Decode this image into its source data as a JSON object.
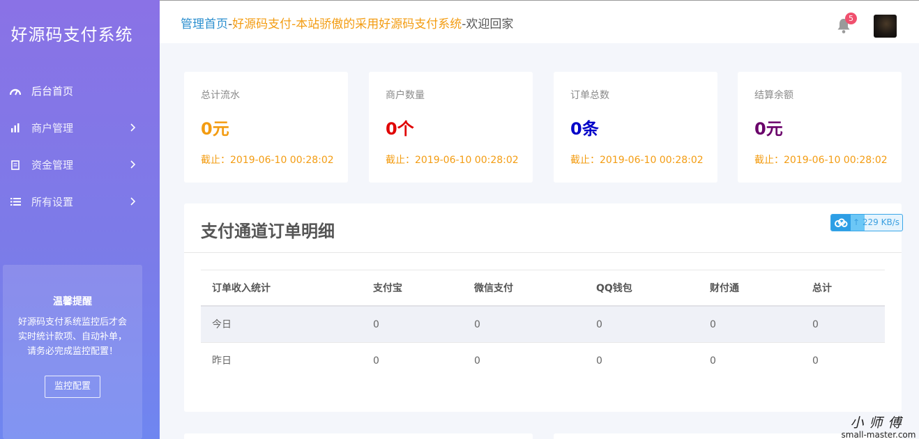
{
  "brand": "好源码支付系统",
  "sidebar": {
    "items": [
      {
        "label": "后台首页",
        "icon": "dashboard-icon",
        "active": true,
        "has_children": false
      },
      {
        "label": "商户管理",
        "icon": "bar-chart-icon",
        "active": false,
        "has_children": true
      },
      {
        "label": "资金管理",
        "icon": "document-icon",
        "active": false,
        "has_children": true
      },
      {
        "label": "所有设置",
        "icon": "list-icon",
        "active": false,
        "has_children": true
      }
    ],
    "notice": {
      "title": "温馨提醒",
      "text": "好源码支付系统监控后才会实时统计款项、自动补单，请务必完成监控配置！",
      "button": "监控配置"
    }
  },
  "header": {
    "crumb_home": "管理首页",
    "crumb_sep1": "-",
    "crumb_site": "好源码支付-本站骄傲的采用好源码支付系统",
    "crumb_sep2": "-",
    "crumb_welcome": "欢迎回家",
    "notification_count": "5"
  },
  "stats": [
    {
      "label": "总计流水",
      "value": "0元",
      "color": "#f39c12",
      "date": "截止：2019-06-10 00:28:02"
    },
    {
      "label": "商户数量",
      "value": "0个",
      "color": "#e00000",
      "date": "截止：2019-06-10 00:28:02"
    },
    {
      "label": "订单总数",
      "value": "0条",
      "color": "#0000c8",
      "date": "截止：2019-06-10 00:28:02"
    },
    {
      "label": "结算余额",
      "value": "0元",
      "color": "#6a006a",
      "date": "截止：2019-06-10 00:28:02"
    }
  ],
  "panel": {
    "title": "支付通道订单明细",
    "columns": [
      "订单收入统计",
      "支付宝",
      "微信支付",
      "QQ钱包",
      "财付通",
      "总计"
    ],
    "rows": [
      [
        "今日",
        "0",
        "0",
        "0",
        "0",
        "0"
      ],
      [
        "昨日",
        "0",
        "0",
        "0",
        "0",
        "0"
      ]
    ]
  },
  "speed_widget": {
    "text": "229 KB/s",
    "icon": "cloud-upload-icon"
  },
  "watermark": {
    "cn": "小师傅",
    "en": "small-master.com"
  },
  "colors": {
    "sidebar_top": "#8a72e6",
    "sidebar_bottom": "#6f86f0",
    "accent_blue": "#2c8fcf",
    "accent_orange": "#f39c12"
  }
}
